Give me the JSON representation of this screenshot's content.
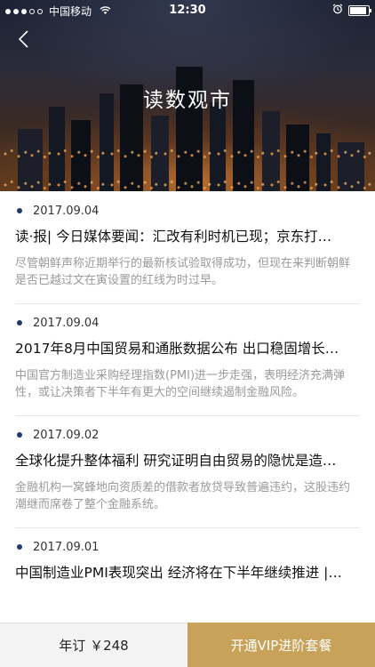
{
  "status_bar": {
    "carrier": "中国移动",
    "time": "12:30"
  },
  "header": {
    "title": "读数观市"
  },
  "articles": [
    {
      "date": "2017.09.04",
      "title": "读·报| 今日媒体要闻：汇改有利时机已现；京东打…",
      "summary": "尽管朝鲜声称近期举行的最新核试验取得成功，但现在来判断朝鲜是否已越过文在寅设置的红线为时过早。"
    },
    {
      "date": "2017.09.04",
      "title": "2017年8月中国贸易和通胀数据公布 出口稳固增长…",
      "summary": "中国官方制造业采购经理指数(PMI)进一步走强，表明经济充满弹性，或让决策者下半年有更大的空间继续遏制金融风险。"
    },
    {
      "date": "2017.09.02",
      "title": "全球化提升整体福利 研究证明自由贸易的隐忧是造…",
      "summary": "金融机构一窝蜂地向资质差的借款者放贷导致普遍违约，这股违约潮继而席卷了整个金融系统。"
    },
    {
      "date": "2017.09.01",
      "title": "中国制造业PMI表现突出 经济将在下半年继续推进 |…",
      "summary": ""
    }
  ],
  "bottom_bar": {
    "price_label": "年订 ￥248",
    "vip_label": "开通VIP进阶套餐"
  },
  "colors": {
    "accent_gold": "#c7a258",
    "bullet_navy": "#1e3a6e"
  },
  "icons": {
    "back": "chevron-left-icon",
    "wifi": "wifi-icon",
    "alarm": "alarm-icon",
    "battery": "battery-icon"
  }
}
